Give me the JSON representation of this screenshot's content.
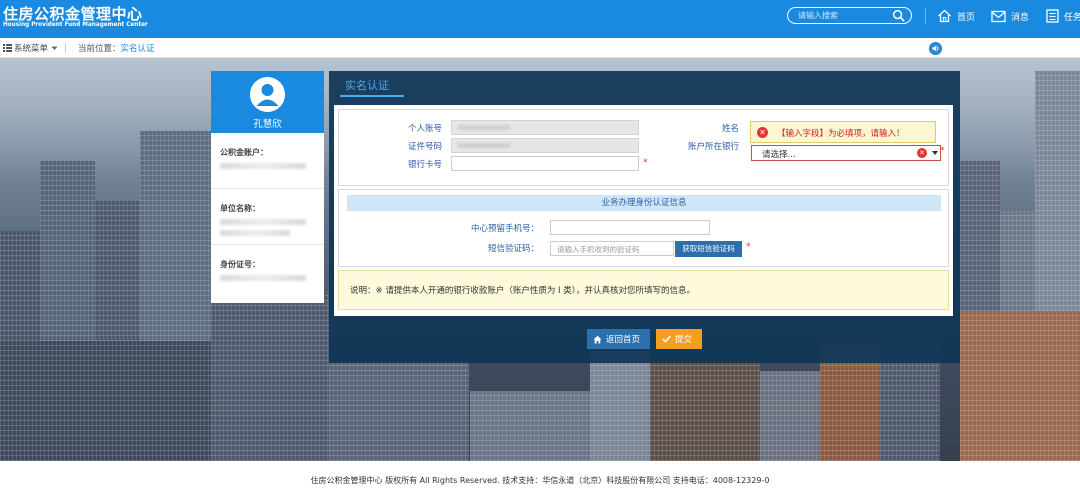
{
  "header": {
    "title": "住房公积金管理中心",
    "subtitle": "Housing Provident Fund Management Center",
    "search_placeholder": "请输入搜索",
    "nav": [
      {
        "label": "首页",
        "icon": "home-icon"
      },
      {
        "label": "消息",
        "icon": "mail-icon"
      },
      {
        "label": "任务",
        "icon": "task-icon"
      }
    ]
  },
  "breadcrumb": {
    "menu_label": "系统菜单",
    "prefix": "当前位置：",
    "current": "实名认证"
  },
  "user": {
    "name": "孔慧欣",
    "fields": [
      {
        "label": "公积金账户："
      },
      {
        "label": "单位名称："
      },
      {
        "label": "身份证号："
      }
    ]
  },
  "panel": {
    "tab": "实名认证",
    "fields": {
      "account_label": "个人账号",
      "id_label": "证件号码",
      "card_label": "银行卡号",
      "name_label": "姓名",
      "bank_label": "账户所在银行"
    },
    "tooltip": "【输入字段】为必填项，请输入！",
    "bank_select": {
      "value": "请选择..."
    },
    "verify": {
      "title": "业务办理身份认证信息",
      "phone_label": "中心预留手机号：",
      "sms_label": "短信验证码：",
      "sms_placeholder": "请输入手机收到的验证码",
      "sms_button": "获取短信验证码"
    },
    "note": "说明：※ 请提供本人开通的银行收款账户（账户性质为 I 类），并认真核对您所填写的信息。",
    "buttons": {
      "home": "返回首页",
      "submit": "提交"
    },
    "required_mark": "*"
  },
  "footer": {
    "text": "住房公积金管理中心 版权所有 All Rights Reserved. 技术支持：华信永道（北京）科技股份有限公司 支持电话：4008-12329-0"
  },
  "colors": {
    "brand": "#1a8ae0",
    "panel": "#103656",
    "submit": "#f5a01c",
    "error": "#e03333"
  }
}
